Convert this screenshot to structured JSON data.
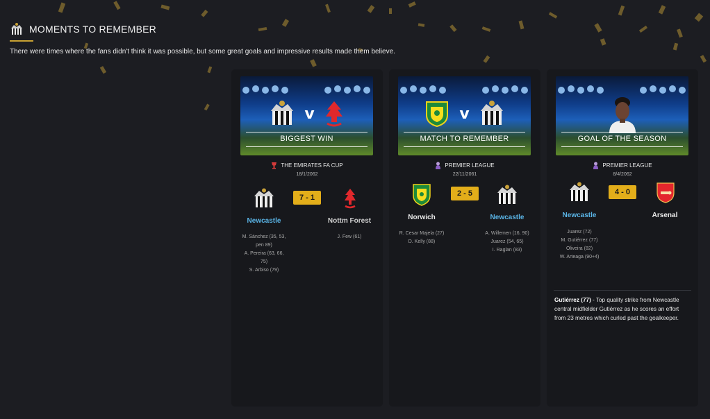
{
  "page": {
    "title": "MOMENTS TO REMEMBER",
    "subtitle": "There were times where the fans didn't think it was possible, but some great goals and impressive results made them believe.",
    "accent_color": "#c9a233"
  },
  "cards": [
    {
      "banner_label": "BIGGEST WIN",
      "banner_crests": [
        "newcastle-crest",
        "nottm-forest-crest"
      ],
      "banner_vs": "v",
      "competition": "THE EMIRATES FA CUP",
      "competition_icon": "fa-cup-icon",
      "date": "18/1/2062",
      "score": "7 - 1",
      "home": {
        "name": "Newcastle",
        "crest": "newcastle-crest"
      },
      "away": {
        "name": "Nottm Forest",
        "crest": "nottm-forest-crest"
      },
      "home_scorers": [
        "M. Sánchez (35, 53,",
        "pen 89)",
        "A. Pereira (63, 66,",
        "75)",
        "S. Arbiso (79)"
      ],
      "away_scorers": [
        "J. Few (61)"
      ]
    },
    {
      "banner_label": "MATCH TO REMEMBER",
      "banner_crests": [
        "norwich-crest",
        "newcastle-crest"
      ],
      "banner_vs": "v",
      "competition": "PREMIER LEAGUE",
      "competition_icon": "premier-league-icon",
      "date": "22/11/2061",
      "score": "2 - 5",
      "home": {
        "name": "Norwich",
        "crest": "norwich-crest"
      },
      "away": {
        "name": "Newcastle",
        "crest": "newcastle-crest"
      },
      "home_scorers": [
        "R. Cesar Majela (27)",
        "D. Kelly (88)"
      ],
      "away_scorers": [
        "A. Willemen (16, 90)",
        "Juarez (54, 65)",
        "I. Raglan (83)"
      ]
    },
    {
      "banner_label": "GOAL OF THE SEASON",
      "banner_image": "player-photo",
      "competition": "PREMIER LEAGUE",
      "competition_icon": "premier-league-icon",
      "date": "8/4/2062",
      "score": "4 - 0",
      "home": {
        "name": "Newcastle",
        "crest": "newcastle-crest"
      },
      "away": {
        "name": "Arsenal",
        "crest": "arsenal-crest"
      },
      "home_scorers": [
        "Juarez (72)",
        "M. Gutiérrez (77)",
        "Oliveira (82)",
        "W. Arteaga (90+4)"
      ],
      "away_scorers": [],
      "goal_scorer": "Gutiérrez (77)",
      "goal_description": " - Top quality strike from Newcastle central midfielder Gutiérrez as he scores an effort from 23 metres which curled past the goalkeeper."
    }
  ]
}
